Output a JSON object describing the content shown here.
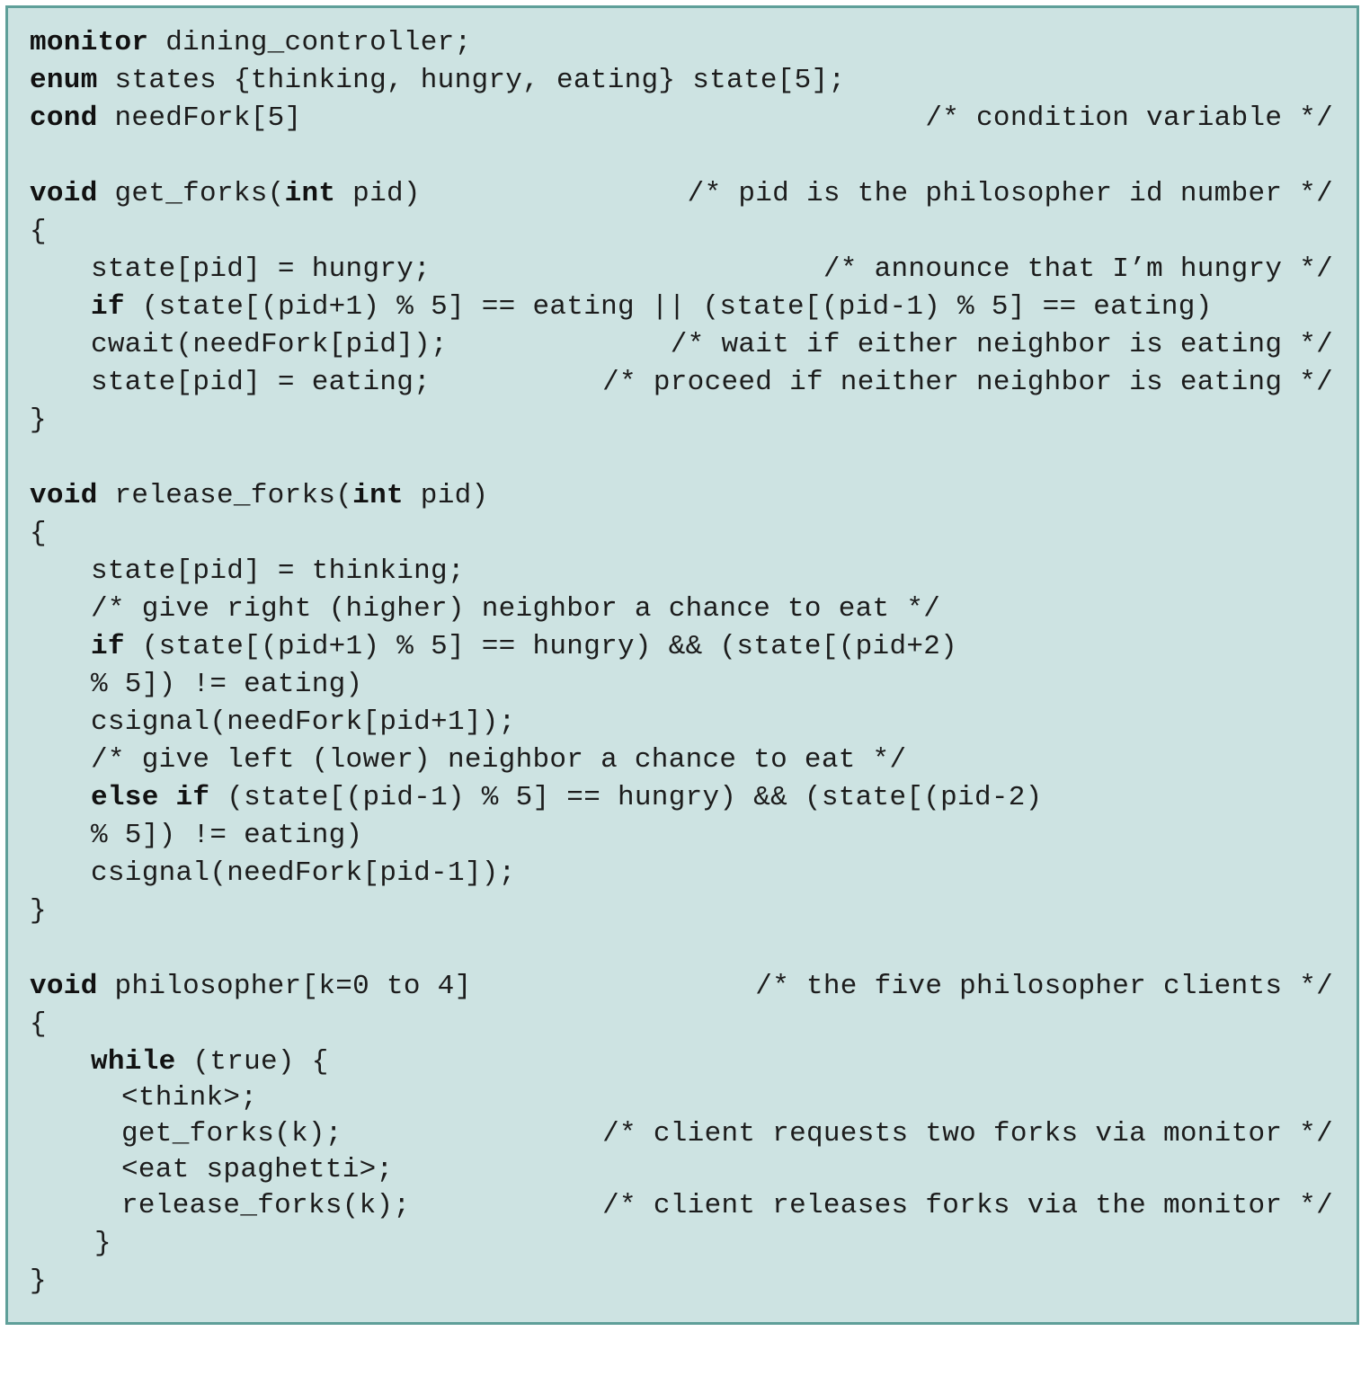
{
  "code": {
    "l1_kw": "monitor",
    "l1_rest": " dining_controller;",
    "l2_kw": "enum",
    "l2_rest": " states {thinking, hungry, eating} state[5];",
    "l3_kw": "cond",
    "l3_rest": " needFork[5]",
    "l3_comment": "/* condition variable */",
    "l5_kw1": "void",
    "l5_mid": " get_forks(",
    "l5_kw2": "int",
    "l5_end": " pid)",
    "l5_comment": "/* pid is the philosopher id number */",
    "l6": "{",
    "l7": "state[pid] = hungry;",
    "l7_comment": "/* announce that I’m hungry */",
    "l8_kw": "if",
    "l8_rest": " (state[(pid+1) % 5] == eating || (state[(pid-1) % 5] == eating)",
    "l9": "cwait(needFork[pid]);",
    "l9_comment": "/* wait if either neighbor is eating */",
    "l10": "state[pid] = eating;",
    "l10_comment": "/* proceed if neither neighbor is eating */",
    "l11": "}",
    "l13_kw1": "void",
    "l13_mid": " release_forks(",
    "l13_kw2": "int",
    "l13_end": " pid)",
    "l14": "{",
    "l15": "state[pid] = thinking;",
    "l16": "/* give right (higher) neighbor a chance to eat */",
    "l17_kw": "if",
    "l17_rest": " (state[(pid+1) % 5] == hungry) && (state[(pid+2)",
    "l18": "% 5]) != eating)",
    "l19": "csignal(needFork[pid+1]);",
    "l20": "/* give left (lower) neighbor a chance to eat */",
    "l21_kw": "else if",
    "l21_rest": " (state[(pid-1) % 5] == hungry) && (state[(pid-2)",
    "l22": "% 5]) != eating)",
    "l23": "csignal(needFork[pid-1]);",
    "l24": "}",
    "l26_kw": "void",
    "l26_rest": " philosopher[k=0 to 4]",
    "l26_comment": "/* the five philosopher clients */",
    "l27": "{",
    "l28_kw": "while",
    "l28_rest": " (true) {",
    "l29": "<think>;",
    "l30": "get_forks(k);",
    "l30_comment": "/* client requests two forks via monitor */",
    "l31": "<eat spaghetti>;",
    "l32": "release_forks(k);",
    "l32_comment": "/* client releases forks via the monitor */",
    "l33": "}",
    "l34": "}"
  }
}
